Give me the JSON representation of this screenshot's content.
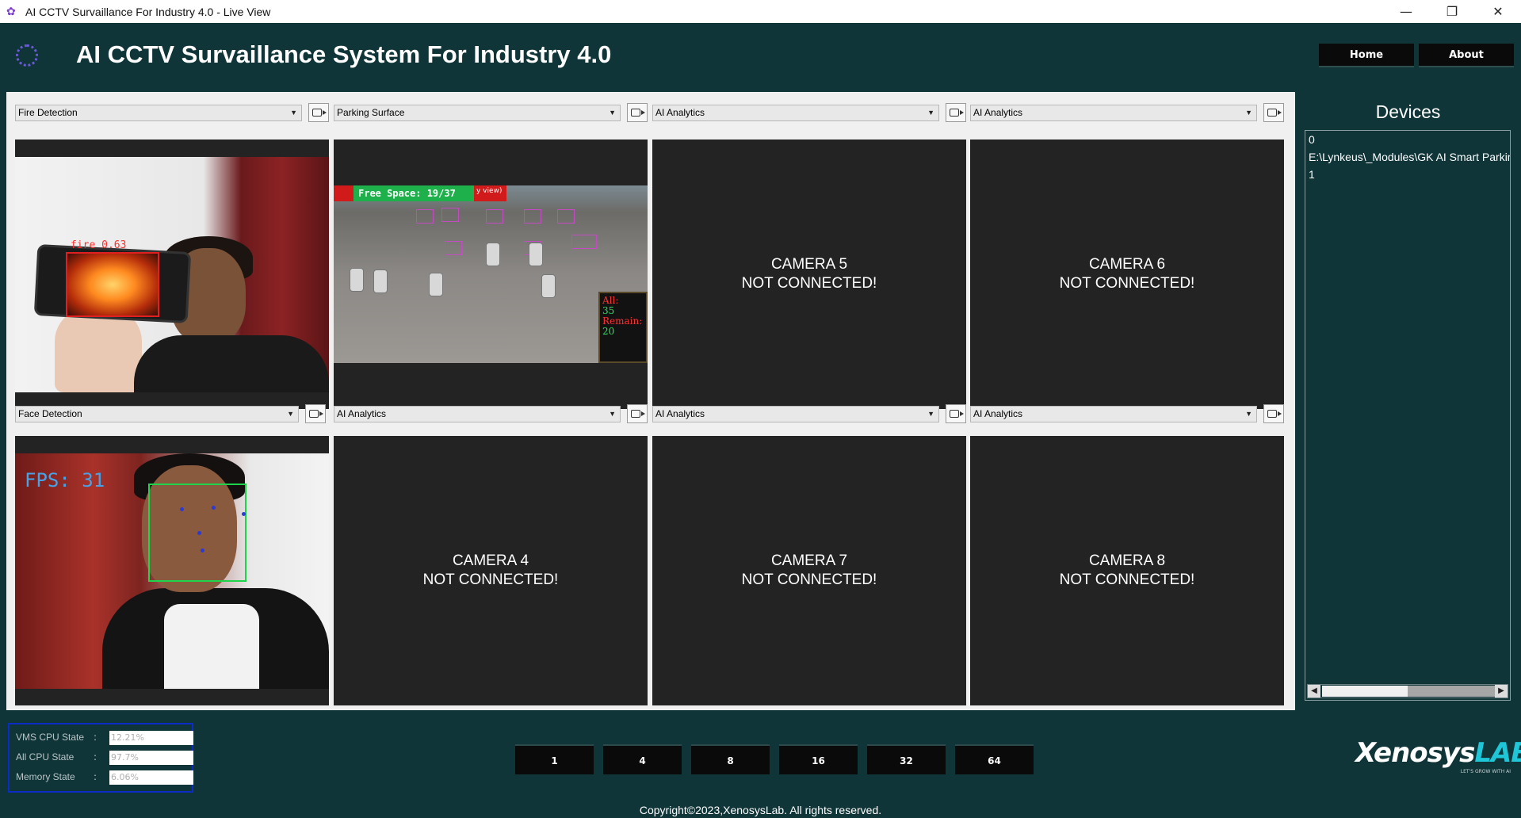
{
  "window": {
    "title": "AI CCTV Survaillance For Industry 4.0 - Live View",
    "controls": [
      "—",
      "❐",
      "✕"
    ]
  },
  "header": {
    "app_title": "AI CCTV Survaillance System For Industry 4.0",
    "nav": [
      "Home",
      "About"
    ]
  },
  "cameras": {
    "cam1": {
      "mode": "Fire Detection",
      "feed_label": "fire 0.63"
    },
    "cam2": {
      "mode": "Parking Surface",
      "free_space": "Free Space: 19/37",
      "banner_tail": "y view)",
      "info_all_label": "All:",
      "info_all": "35",
      "info_remain_label": "Remain:",
      "info_remain": "20"
    },
    "cam3": {
      "mode": "Face Detection",
      "fps": "FPS: 31"
    },
    "cam4": {
      "mode": "AI Analytics",
      "line1": "CAMERA 4",
      "line2": "NOT CONNECTED!"
    },
    "cam5": {
      "mode": "AI Analytics",
      "line1": "CAMERA 5",
      "line2": "NOT CONNECTED!"
    },
    "cam6": {
      "mode": "AI Analytics",
      "line1": "CAMERA 6",
      "line2": "NOT CONNECTED!"
    },
    "cam7": {
      "mode": "AI Analytics",
      "line1": "CAMERA 7",
      "line2": "NOT CONNECTED!"
    },
    "cam8": {
      "mode": "AI Analytics",
      "line1": "CAMERA 8",
      "line2": "NOT CONNECTED!"
    }
  },
  "devices": {
    "title": "Devices",
    "items": [
      "0",
      "E:\\Lynkeus\\_Modules\\GK AI Smart Parking",
      "1"
    ]
  },
  "stats": {
    "vms_cpu_label": "VMS CPU State",
    "vms_cpu": "12.21%",
    "all_cpu_label": "All CPU State",
    "all_cpu": "97.7%",
    "memory_label": "Memory State",
    "memory": "6.06%"
  },
  "layouts": [
    "1",
    "4",
    "8",
    "16",
    "32",
    "64"
  ],
  "brand": {
    "name_part1": "Xenosys",
    "name_part2": "LAB",
    "tagline": "LET'S GROW WITH AI"
  },
  "footer": "Copyright©2023,XenosysLab. All rights reserved.",
  "colors": {
    "background": "#0f3539",
    "button": "#0a0a0a",
    "stats_border": "#0b2cc7"
  }
}
